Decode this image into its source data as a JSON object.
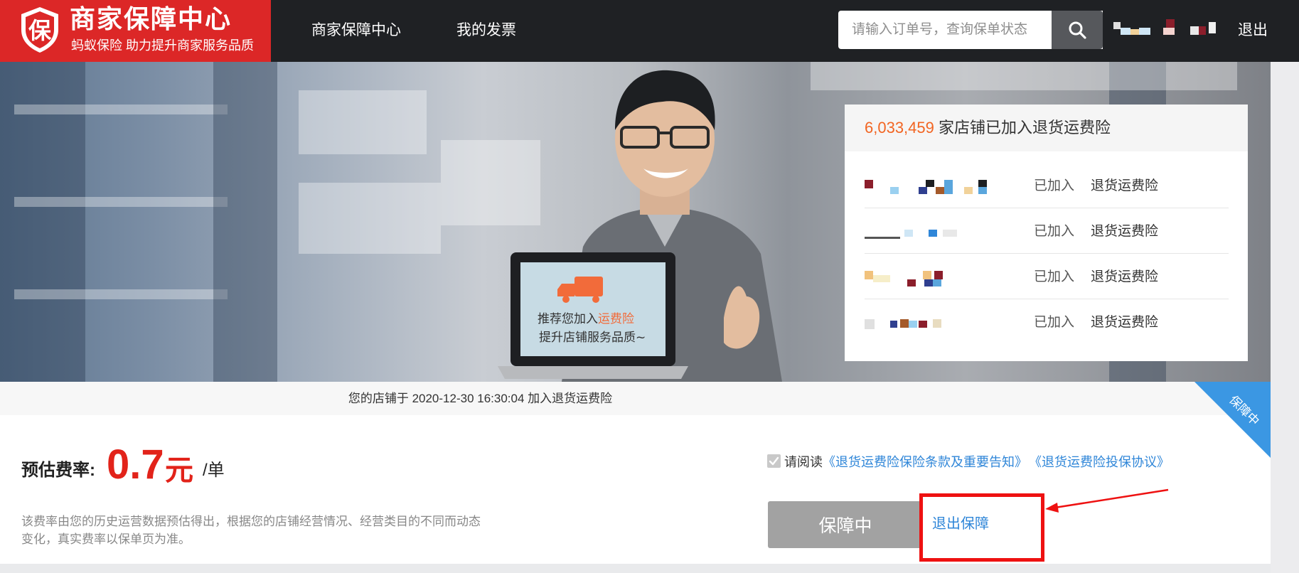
{
  "brand": {
    "title": "商家保障中心",
    "subtitle": "蚂蚁保险 助力提升商家服务品质",
    "badge_char": "保",
    "color": "#dc2727"
  },
  "nav": {
    "items": [
      {
        "label": "商家保障中心"
      },
      {
        "label": "我的发票"
      }
    ]
  },
  "search": {
    "placeholder": "请输入订单号，查询保单状态"
  },
  "user": {
    "logout_label": "退出"
  },
  "banner": {
    "laptop_line1_prefix": "推荐您加入",
    "laptop_line1_highlight": "运费险",
    "laptop_line2": "提升店铺服务品质~"
  },
  "stats": {
    "count": "6,033,459",
    "title_suffix": " 家店铺已加入退货运费险",
    "rows": [
      {
        "status": "已加入",
        "product": "退货运费险"
      },
      {
        "status": "已加入",
        "product": "退货运费险"
      },
      {
        "status": "已加入",
        "product": "退货运费险"
      },
      {
        "status": "已加入",
        "product": "退货运费险"
      }
    ]
  },
  "panel": {
    "join_note": "您的店铺于 2020-12-30 16:30:04 加入退货运费险",
    "ribbon": "保障中",
    "rate_label": "预估费率:",
    "rate_value": "0.7",
    "rate_currency": "元",
    "rate_per": "/单",
    "rate_note": "该费率由您的历史运营数据预估得出，根据您的店铺经营情况、经营类目的不同而动态变化，真实费率以保单页为准。",
    "agree_prefix": "请阅读",
    "agree_link1": "《退货运费险保险条款及重要告知》",
    "agree_link2": "《退货运费险投保协议》",
    "agree_checked": true,
    "status_button": "保障中",
    "exit_link": "退出保障"
  },
  "colors": {
    "accent_blue": "#2f86d8",
    "price_red": "#e2231a",
    "count_orange": "#f26522",
    "annotation_red": "#ee1111"
  }
}
